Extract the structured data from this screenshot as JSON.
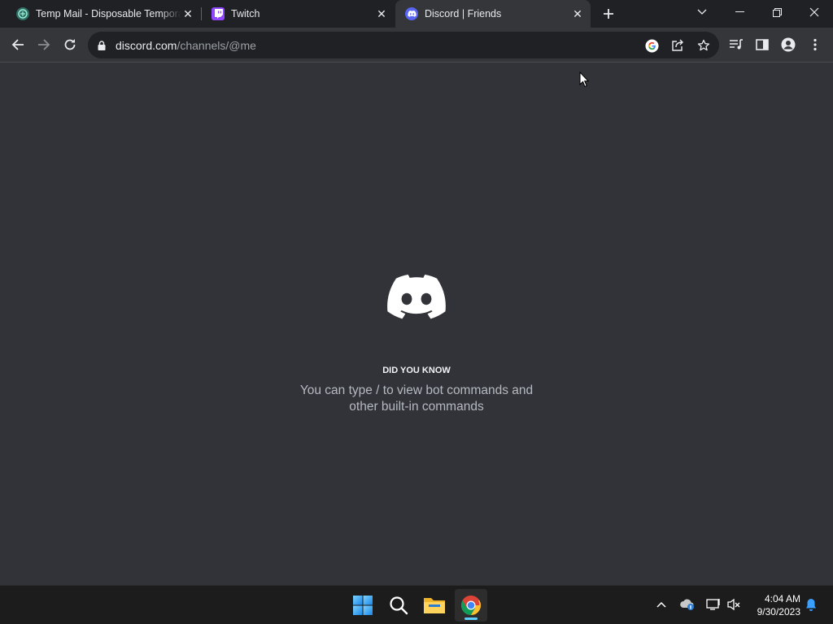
{
  "browser": {
    "tabs": [
      {
        "title": "Temp Mail - Disposable Temporary",
        "favicon": "tempmail-favicon",
        "active": false
      },
      {
        "title": "Twitch",
        "favicon": "twitch-favicon",
        "active": false
      },
      {
        "title": "Discord | Friends",
        "favicon": "discord-favicon",
        "active": true
      }
    ],
    "url_host": "discord.com",
    "url_path": "/channels/@me"
  },
  "page": {
    "eyebrow": "DID YOU KNOW",
    "tip": "You can type / to view bot commands and other built-in commands"
  },
  "taskbar": {
    "apps": [
      "windows-start",
      "search",
      "file-explorer",
      "chrome"
    ],
    "active_app": "chrome",
    "time": "4:04 AM",
    "date": "9/30/2023"
  },
  "colors": {
    "page_bg": "#313338",
    "toolbar_bg": "#35363a",
    "tabstrip_bg": "#202124",
    "discord_blurple": "#5865f2",
    "twitch_purple": "#9146ff"
  }
}
